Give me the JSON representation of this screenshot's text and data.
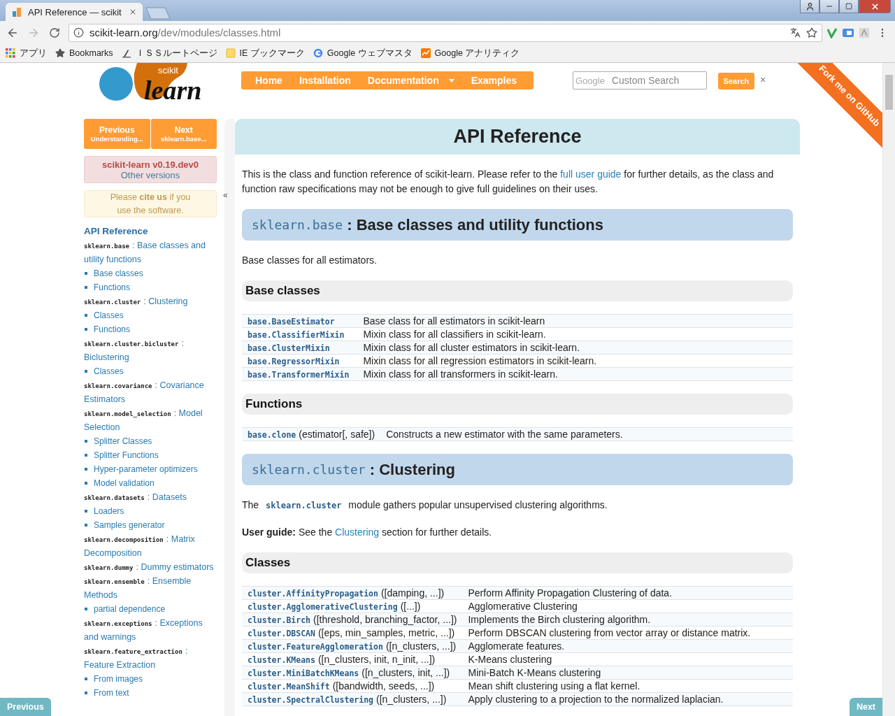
{
  "browser": {
    "tab_title": "API Reference — scikit",
    "url_host": "scikit-learn.org",
    "url_path": "/dev/modules/classes.html",
    "bookmarks": [
      {
        "kind": "apps",
        "label": "アプリ"
      },
      {
        "kind": "star",
        "label": "Bookmarks"
      },
      {
        "kind": "site",
        "label": "ＩＳＳルートページ"
      },
      {
        "kind": "folder",
        "label": "IE ブックマーク"
      },
      {
        "kind": "google",
        "label": "Google ウェブマスタ"
      },
      {
        "kind": "analytics",
        "label": "Google アナリティク"
      }
    ]
  },
  "header": {
    "logo": {
      "top": "scikit",
      "bottom": "learn"
    },
    "nav": [
      {
        "label": "Home",
        "dropdown": false
      },
      {
        "label": "Installation",
        "dropdown": false
      },
      {
        "label": "Documentation",
        "dropdown": true
      },
      {
        "label": "Examples",
        "dropdown": false
      }
    ],
    "search": {
      "brand": "Google",
      "placeholder": "Custom Search",
      "button": "Search",
      "clear": "×"
    },
    "ribbon": "Fork me on GitHub"
  },
  "sidebar": {
    "prev": {
      "label": "Previous",
      "sub": "Understanding..."
    },
    "next": {
      "label": "Next",
      "sub": "sklearn.base..."
    },
    "version": {
      "title": "scikit-learn v0.19.dev0",
      "link": "Other versions"
    },
    "cite": "Please **cite us** if you use the software.",
    "collapse": "«",
    "toc_title": "API Reference",
    "toc": [
      {
        "code": "sklearn.base",
        "sep": ":",
        "title": "Base classes and utility functions",
        "children": [
          {
            "label": "Base classes"
          },
          {
            "label": "Functions"
          }
        ]
      },
      {
        "code": "sklearn.cluster",
        "sep": ":",
        "title": "Clustering",
        "children": [
          {
            "label": "Classes"
          },
          {
            "label": "Functions"
          }
        ]
      },
      {
        "code": "sklearn.cluster.bicluster",
        "sep": ":",
        "title": "Biclustering",
        "children": [
          {
            "label": "Classes"
          }
        ]
      },
      {
        "code": "sklearn.covariance",
        "sep": ":",
        "title": "Covariance Estimators"
      },
      {
        "code": "sklearn.model_selection",
        "sep": ":",
        "title": "Model Selection",
        "children": [
          {
            "label": "Splitter Classes"
          },
          {
            "label": "Splitter Functions"
          },
          {
            "label": "Hyper-parameter optimizers"
          },
          {
            "label": "Model validation"
          }
        ]
      },
      {
        "code": "sklearn.datasets",
        "sep": ":",
        "title": "Datasets",
        "children": [
          {
            "label": "Loaders"
          },
          {
            "label": "Samples generator"
          }
        ]
      },
      {
        "code": "sklearn.decomposition",
        "sep": ":",
        "title": "Matrix Decomposition"
      },
      {
        "code": "sklearn.dummy",
        "sep": ":",
        "title": "Dummy estimators"
      },
      {
        "code": "sklearn.ensemble",
        "sep": ":",
        "title": "Ensemble Methods",
        "children": [
          {
            "label": "partial dependence"
          }
        ]
      },
      {
        "code": "sklearn.exceptions",
        "sep": ":",
        "title": "Exceptions and warnings"
      },
      {
        "code": "sklearn.feature_extraction",
        "sep": ":",
        "title": "Feature Extraction",
        "children": [
          {
            "label": "From images"
          },
          {
            "label": "From text"
          }
        ]
      }
    ]
  },
  "main": {
    "title": "API Reference",
    "blocks": [
      {
        "kind": "paragraph",
        "runs": [
          {
            "kind": "text",
            "text": "This is the class and function reference of scikit-learn. Please refer to the "
          },
          {
            "kind": "link",
            "text": "full user guide"
          },
          {
            "kind": "text",
            "text": " for further details, as the class and function raw specifications may not be enough to give full guidelines on their uses."
          }
        ]
      },
      {
        "kind": "module",
        "code": "sklearn.base",
        "sep": ":",
        "title": "Base classes and utility functions"
      },
      {
        "kind": "paragraph",
        "runs": [
          {
            "kind": "text",
            "text": "Base classes for all estimators."
          }
        ]
      },
      {
        "kind": "subheading",
        "text": "Base classes"
      },
      {
        "kind": "table",
        "rows": [
          {
            "name": "base.BaseEstimator",
            "description": "Base class for all estimators in scikit-learn"
          },
          {
            "name": "base.ClassifierMixin",
            "description": "Mixin class for all classifiers in scikit-learn."
          },
          {
            "name": "base.ClusterMixin",
            "description": "Mixin class for all cluster estimators in scikit-learn."
          },
          {
            "name": "base.RegressorMixin",
            "description": "Mixin class for all regression estimators in scikit-learn."
          },
          {
            "name": "base.TransformerMixin",
            "description": "Mixin class for all transformers in scikit-learn."
          }
        ]
      },
      {
        "kind": "subheading",
        "text": "Functions"
      },
      {
        "kind": "table",
        "rows": [
          {
            "name": "base.clone",
            "args": "(estimator[, safe])",
            "description": "Constructs a new estimator with the same parameters."
          }
        ]
      },
      {
        "kind": "module",
        "code": "sklearn.cluster",
        "sep": ":",
        "title": "Clustering"
      },
      {
        "kind": "paragraph",
        "runs": [
          {
            "kind": "text",
            "text": "The "
          },
          {
            "kind": "code",
            "text": "sklearn.cluster"
          },
          {
            "kind": "text",
            "text": " module gathers popular unsupervised clustering algorithms."
          }
        ]
      },
      {
        "kind": "paragraph",
        "runs": [
          {
            "kind": "text",
            "text": "**User guide:** See the "
          },
          {
            "kind": "link",
            "text": "Clustering"
          },
          {
            "kind": "text",
            "text": " section for further details."
          }
        ]
      },
      {
        "kind": "subheading",
        "text": "Classes"
      },
      {
        "kind": "table",
        "rows": [
          {
            "name": "cluster.AffinityPropagation",
            "args": "([damping, ...])",
            "description": "Perform Affinity Propagation Clustering of data."
          },
          {
            "name": "cluster.AgglomerativeClustering",
            "args": "([...])",
            "description": "Agglomerative Clustering"
          },
          {
            "name": "cluster.Birch",
            "args": "([threshold, branching_factor, ...])",
            "description": "Implements the Birch clustering algorithm."
          },
          {
            "name": "cluster.DBSCAN",
            "args": "([eps, min_samples, metric, ...])",
            "description": "Perform DBSCAN clustering from vector array or distance matrix."
          },
          {
            "name": "cluster.FeatureAgglomeration",
            "args": "([n_clusters, ...])",
            "description": "Agglomerate features."
          },
          {
            "name": "cluster.KMeans",
            "args": "([n_clusters, init, n_init, ...])",
            "description": "K-Means clustering"
          },
          {
            "name": "cluster.MiniBatchKMeans",
            "args": "([n_clusters, init, ...])",
            "description": "Mini-Batch K-Means clustering"
          },
          {
            "name": "cluster.MeanShift",
            "args": "([bandwidth, seeds, ...])",
            "description": "Mean shift clustering using a flat kernel."
          },
          {
            "name": "cluster.SpectralClustering",
            "args": "([n_clusters, ...])",
            "description": "Apply clustering to a projection to the normalized laplacian."
          }
        ]
      }
    ]
  },
  "footer": {
    "previous": "Previous",
    "next": "Next"
  }
}
